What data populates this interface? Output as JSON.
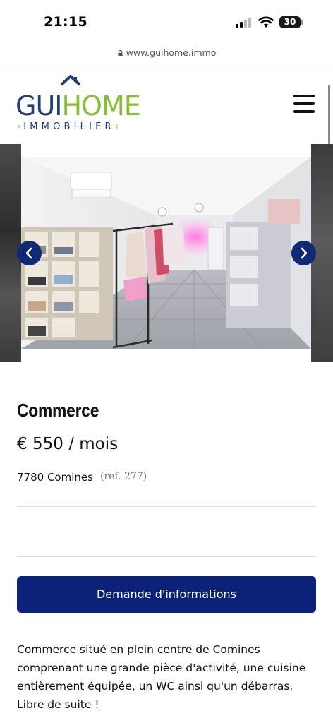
{
  "status_bar": {
    "time": "21:15",
    "battery": "30"
  },
  "browser": {
    "url": "www.guihome.immo"
  },
  "header": {
    "logo_gui": "GUI",
    "logo_home": "HOME",
    "logo_sub": "IMMOBILIER",
    "brand_colors": {
      "navy": "#223e72",
      "green": "#86bf36"
    },
    "menu_icon": "hamburger-menu-icon"
  },
  "gallery": {
    "prev_icon": "chevron-left-icon",
    "next_icon": "chevron-right-icon",
    "accent": "#0f2a73"
  },
  "listing": {
    "type": "Commerce",
    "price": "€ 550 / mois",
    "location": "7780 Comines",
    "ref": "(ref. 277)",
    "cta_label": "Demande d'informations",
    "cta_color": "#0c2278",
    "description": "Commerce situé en plein centre de Comines comprenant une grande pièce d'activité, une cuisine entièrement équipée, un WC ainsi qu'un débarras. Libre de suite !"
  }
}
